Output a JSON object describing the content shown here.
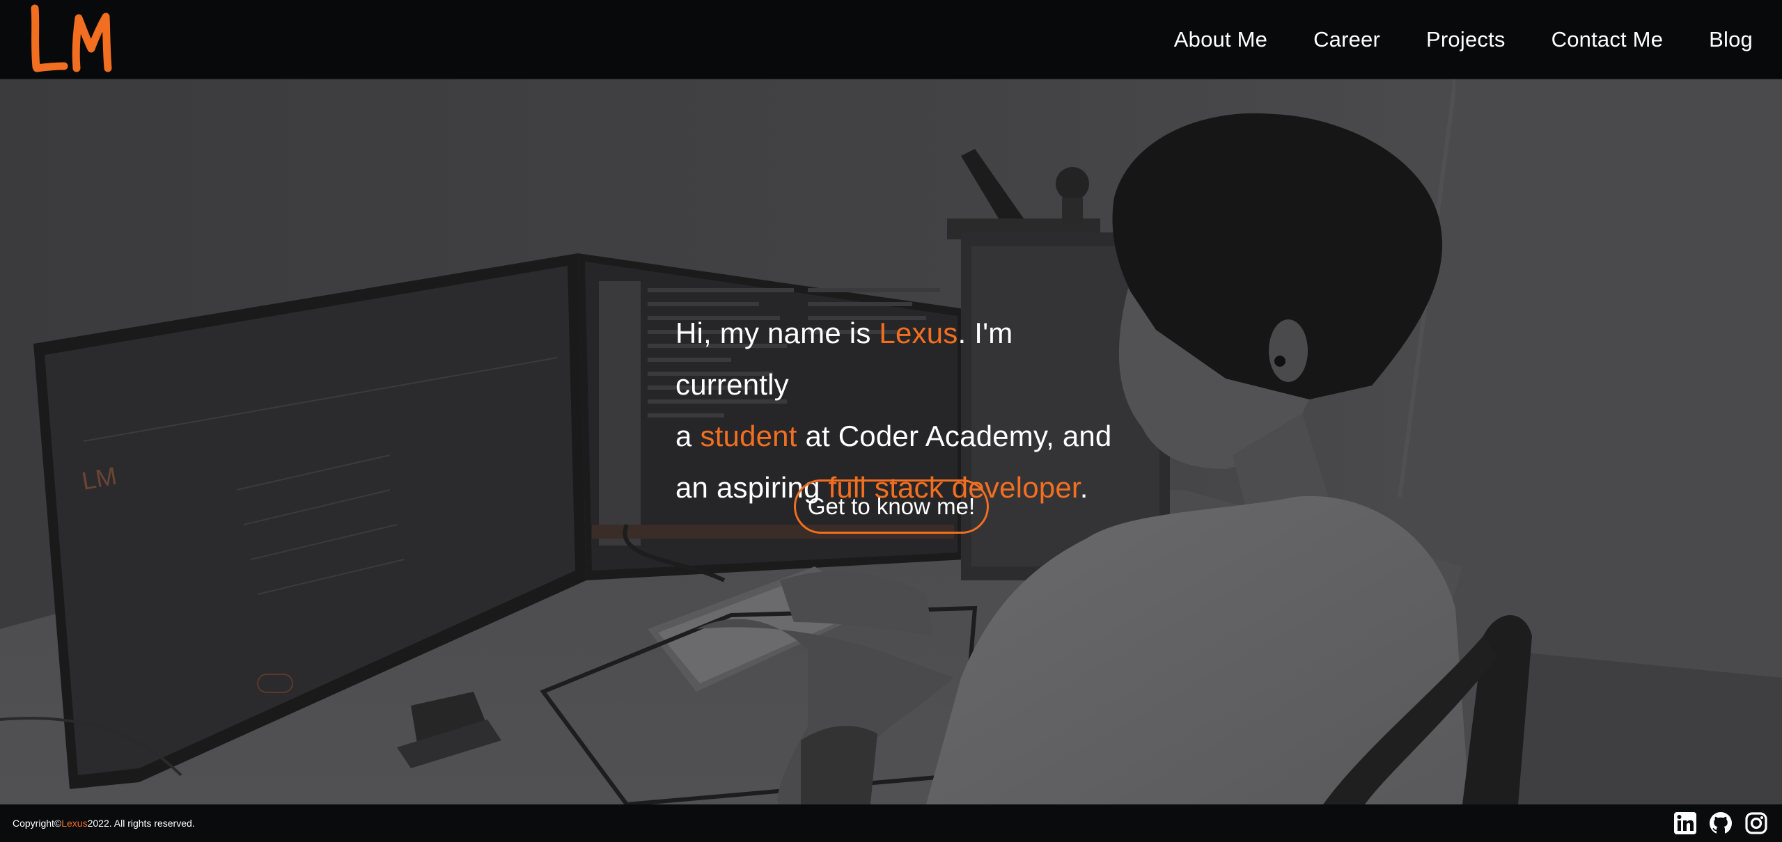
{
  "nav": {
    "logo_text": "LM",
    "links": [
      "About Me",
      "Career",
      "Projects",
      "Contact Me",
      "Blog"
    ]
  },
  "hero": {
    "line1_prefix": "Hi, my name is ",
    "name": "Lexus",
    "line1_suffix": ". I'm currently",
    "line2_prefix": "a ",
    "role": "student",
    "line2_suffix": " at Coder Academy, and",
    "line3_prefix": "an aspiring ",
    "goal": "full stack developer",
    "line3_suffix": ".",
    "cta_label": "Get to know me!",
    "background_photo_description": ""
  },
  "footer": {
    "copyright_prefix": "Copyright© ",
    "copyright_name": "Lexus",
    "copyright_suffix": " 2022. All rights reserved.",
    "social_icons": [
      "linkedin-icon",
      "github-icon",
      "instagram-icon"
    ]
  },
  "colors": {
    "accent": "#f26f21",
    "nav_bg": "#08090b",
    "text": "#ffffff"
  }
}
